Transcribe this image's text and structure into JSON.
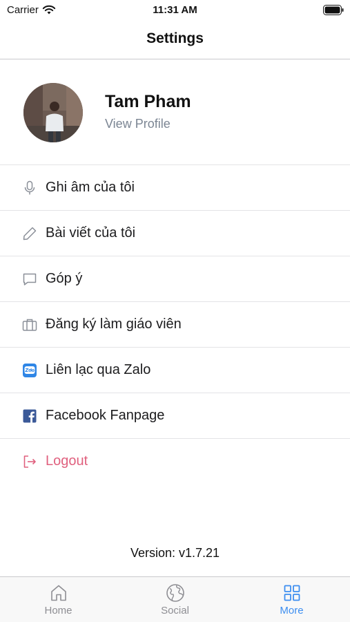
{
  "status_bar": {
    "carrier": "Carrier",
    "time": "11:31 AM"
  },
  "nav": {
    "title": "Settings"
  },
  "profile": {
    "name": "Tam Pham",
    "link": "View Profile"
  },
  "menu": {
    "items": [
      {
        "label": "Ghi âm của tôi",
        "icon": "microphone-icon"
      },
      {
        "label": "Bài viết của tôi",
        "icon": "pencil-icon"
      },
      {
        "label": "Góp ý",
        "icon": "chat-bubble-icon"
      },
      {
        "label": "Đăng ký làm giáo viên",
        "icon": "briefcase-icon"
      },
      {
        "label": "Liên lạc qua Zalo",
        "icon": "zalo-icon"
      },
      {
        "label": "Facebook Fanpage",
        "icon": "facebook-icon"
      },
      {
        "label": "Logout",
        "icon": "logout-icon"
      }
    ]
  },
  "version": "Version: v1.7.21",
  "tabs": [
    {
      "label": "Home",
      "icon": "home-icon",
      "active": false
    },
    {
      "label": "Social",
      "icon": "globe-icon",
      "active": false
    },
    {
      "label": "More",
      "icon": "grid-icon",
      "active": true
    }
  ],
  "colors": {
    "accent": "#3d8ef0",
    "logout": "#e0607e",
    "zalo": "#2f86e6",
    "facebook": "#3b5998"
  }
}
